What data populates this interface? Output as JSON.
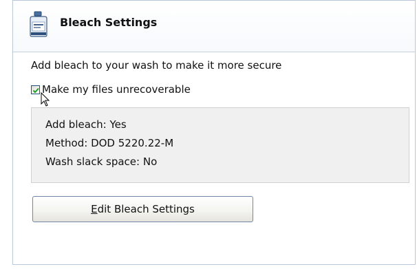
{
  "header": {
    "title": "Bleach Settings",
    "icon": "bleach-bottle-icon"
  },
  "content": {
    "description": "Add bleach to your wash to make it more secure",
    "checkbox": {
      "label": "Make my files unrecoverable",
      "checked": true
    },
    "summary": {
      "add_bleach": "Add bleach: Yes",
      "method": "Method: DOD 5220.22-M",
      "wash_slack": "Wash slack space: No"
    },
    "edit_button": {
      "label_first": "E",
      "label_rest": "dit Bleach Settings"
    }
  },
  "colors": {
    "panel_border": "#b9c7da",
    "summary_bg": "#f0f0f0",
    "checkmark": "#21a121",
    "button_border": "#6f86a5"
  }
}
